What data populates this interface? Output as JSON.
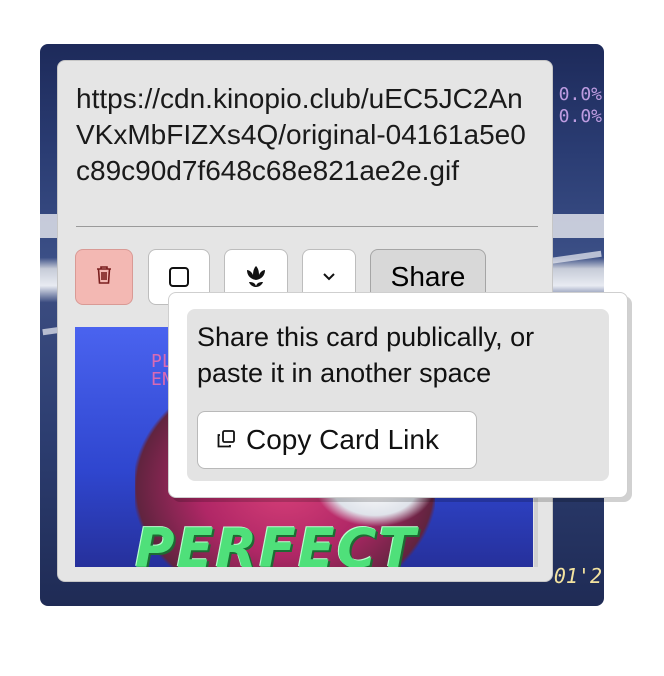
{
  "card": {
    "name": "https://cdn.kinopio.club/uEC5JC2AnVKxMbFIZXs4Q/original-04161a5e0c89c90d7f648c68e821ae2e.gif"
  },
  "toolbar": {
    "delete_icon": "trash-icon",
    "checkbox_icon": "checkbox-icon",
    "frame_icon": "flower-icon",
    "more_icon": "chevron-down-icon",
    "share_label": "Share"
  },
  "share_popover": {
    "description": "Share this card publically, or paste it in another space",
    "copy_link_label": "Copy Card Link",
    "copy_icon": "copy-icon"
  },
  "media": {
    "caption": "PERFECT",
    "hud_text": "PL\nEN"
  },
  "background": {
    "hud_top": "0.0%\n0.0%",
    "timer": "01'2"
  },
  "colors": {
    "delete_bg": "#f3b8b3",
    "card_bg": "#e5e5e5",
    "share_bg": "#d8d8d8"
  }
}
